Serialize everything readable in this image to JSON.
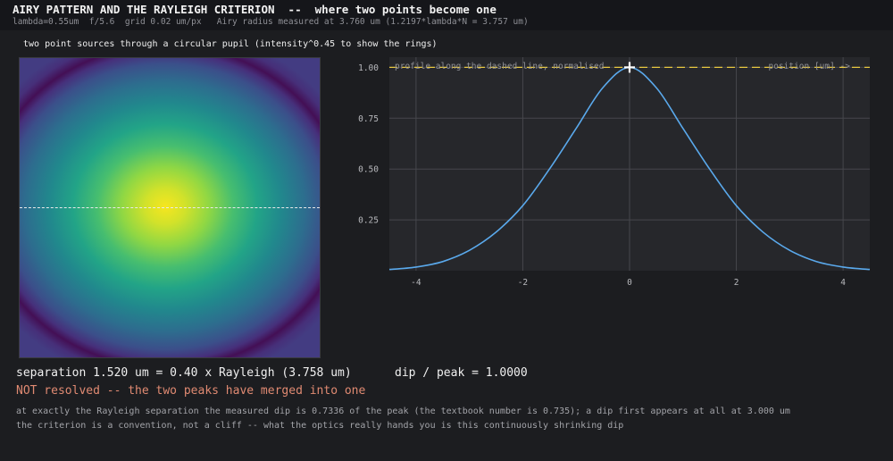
{
  "header": {
    "title": "AIRY PATTERN AND THE RAYLEIGH CRITERION  --  where two points become one",
    "params": "lambda=0.55um  f/5.6  grid 0.02 um/px   Airy radius measured at 3.760 um (1.2197*lambda*N = 3.757 um)"
  },
  "image_panel": {
    "caption": "two point sources through a circular pupil (intensity^0.45 to show the rings)"
  },
  "chart_data": {
    "type": "line",
    "annotation_left": "profile along the dashed line, normalised",
    "annotation_right": "position [um] ->",
    "xlim": [
      -4.5,
      4.5
    ],
    "ylim": [
      0,
      1.05
    ],
    "x_ticks": [
      -4,
      -2,
      0,
      2,
      4
    ],
    "y_ticks": [
      0.25,
      0.5,
      0.75,
      1.0
    ],
    "x_tick_labels": [
      "-4",
      "-2",
      "0",
      "2",
      "4"
    ],
    "y_tick_labels": [
      "0.25",
      "0.50",
      "0.75",
      "1.00"
    ],
    "grid": true,
    "series": [
      {
        "x": [
          -4.5,
          -4.0,
          -3.5,
          -3.0,
          -2.5,
          -2.0,
          -1.5,
          -1.0,
          -0.5,
          0.0,
          0.5,
          1.0,
          1.5,
          2.0,
          2.5,
          3.0,
          3.5,
          4.0,
          4.5
        ],
        "values": [
          0.006,
          0.018,
          0.045,
          0.1,
          0.19,
          0.32,
          0.5,
          0.7,
          0.9,
          1.0,
          0.9,
          0.7,
          0.5,
          0.32,
          0.19,
          0.1,
          0.045,
          0.018,
          0.006
        ],
        "color": "#5aa9ec"
      }
    ],
    "reference_line": {
      "y": 1.0,
      "color": "#e8c840"
    },
    "marker": {
      "x": 0.0,
      "y": 1.0
    }
  },
  "readout": {
    "separation": "separation 1.520 um = 0.40 x Rayleigh (3.758 um)",
    "dip": "dip / peak = 1.0000",
    "status": "NOT resolved -- the two peaks have merged into one",
    "status_color": "#e08a72",
    "note1": "at exactly the Rayleigh separation the measured dip is 0.7336 of the peak (the textbook number is 0.735); a dip first appears at all at 3.000 um",
    "note2": "the criterion is a convention, not a cliff -- what the optics really hands you is this continuously shrinking dip"
  }
}
